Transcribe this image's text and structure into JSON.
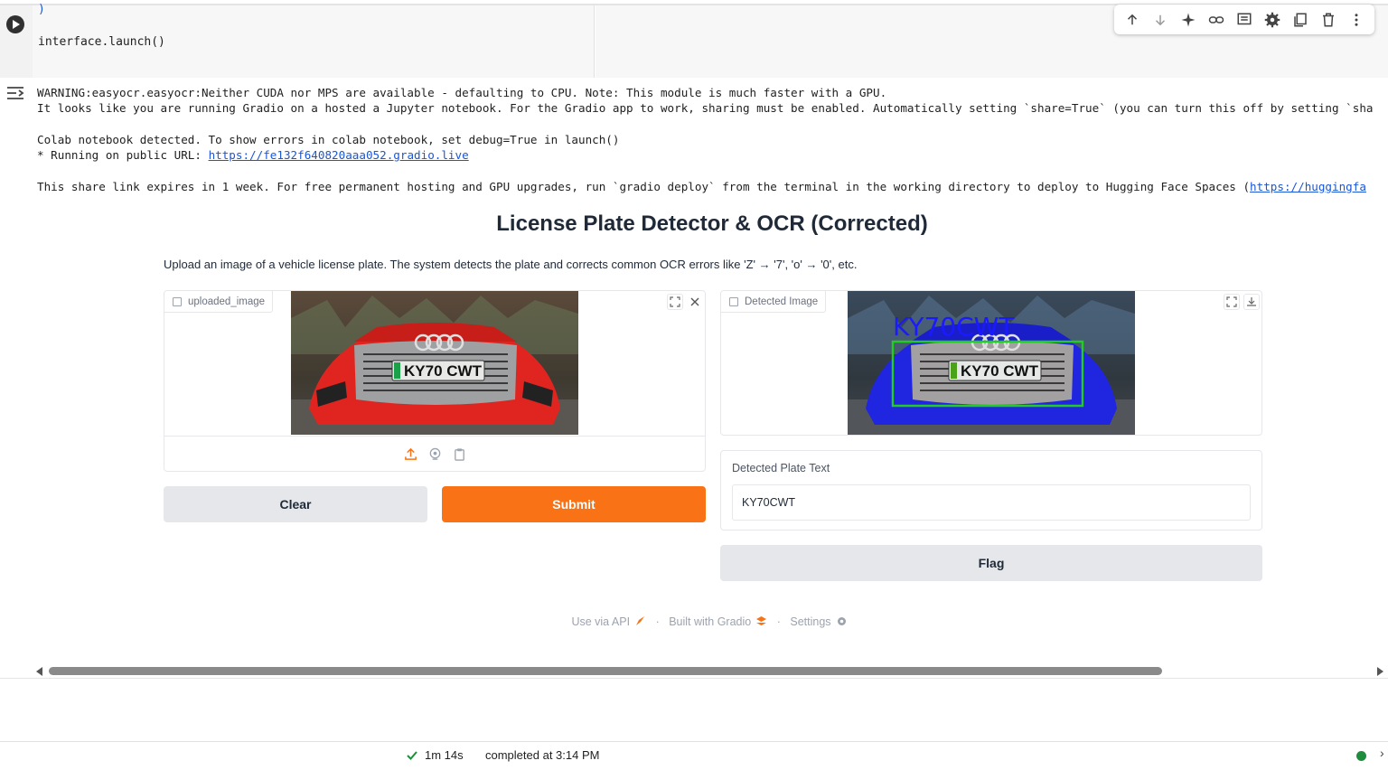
{
  "code_cell": {
    "line_1": ")",
    "line_2": "interface.launch()"
  },
  "cell_toolbar": {
    "icons": [
      "arrow-up-icon",
      "arrow-down-icon",
      "sparkle-icon",
      "link-icon",
      "comment-icon",
      "gear-icon",
      "mirror-cell-icon",
      "trash-icon",
      "more-vert-icon"
    ]
  },
  "output": {
    "line_1": "WARNING:easyocr.easyocr:Neither CUDA nor MPS are available - defaulting to CPU. Note: This module is much faster with a GPU.",
    "line_2": "It looks like you are running Gradio on a hosted a Jupyter notebook. For the Gradio app to work, sharing must be enabled. Automatically setting `share=True` (you can turn this off by setting `sha",
    "line_3": "Colab notebook detected. To show errors in colab notebook, set debug=True in launch()",
    "line_4_prefix": "* Running on public URL: ",
    "public_url": "https://fe132f640820aaa052.gradio.live",
    "line_5_prefix": "This share link expires in 1 week. For free permanent hosting and GPU upgrades, run `gradio deploy` from the terminal in the working directory to deploy to Hugging Face Spaces (",
    "line_5_link": "https://huggingfa"
  },
  "app": {
    "title": "License Plate Detector & OCR (Corrected)",
    "description": "Upload an image of a vehicle license plate. The system detects the plate and corrects common OCR errors like 'Z' → '7', 'o' → '0', etc.",
    "input_image": {
      "label": "uploaded_image",
      "plate_text": "KY70 CWT"
    },
    "output_image": {
      "label": "Detected Image",
      "plate_text": "KY70 CWT",
      "overlay_text": "KY70CWT"
    },
    "buttons": {
      "clear": "Clear",
      "submit": "Submit",
      "flag": "Flag"
    },
    "detected_text": {
      "label": "Detected Plate Text",
      "value": "KY70CWT"
    },
    "footer": {
      "api": "Use via API",
      "built": "Built with Gradio",
      "settings": "Settings"
    }
  },
  "status": {
    "duration": "1m 14s",
    "completed": "completed at 3:14 PM"
  },
  "colors": {
    "primary": "#f97316",
    "secondary": "#e5e7eb",
    "link": "#1a56d6",
    "status_ok": "#1e8e3e",
    "detection_box": "#22cc22",
    "overlay_text": "#1a1aff"
  }
}
